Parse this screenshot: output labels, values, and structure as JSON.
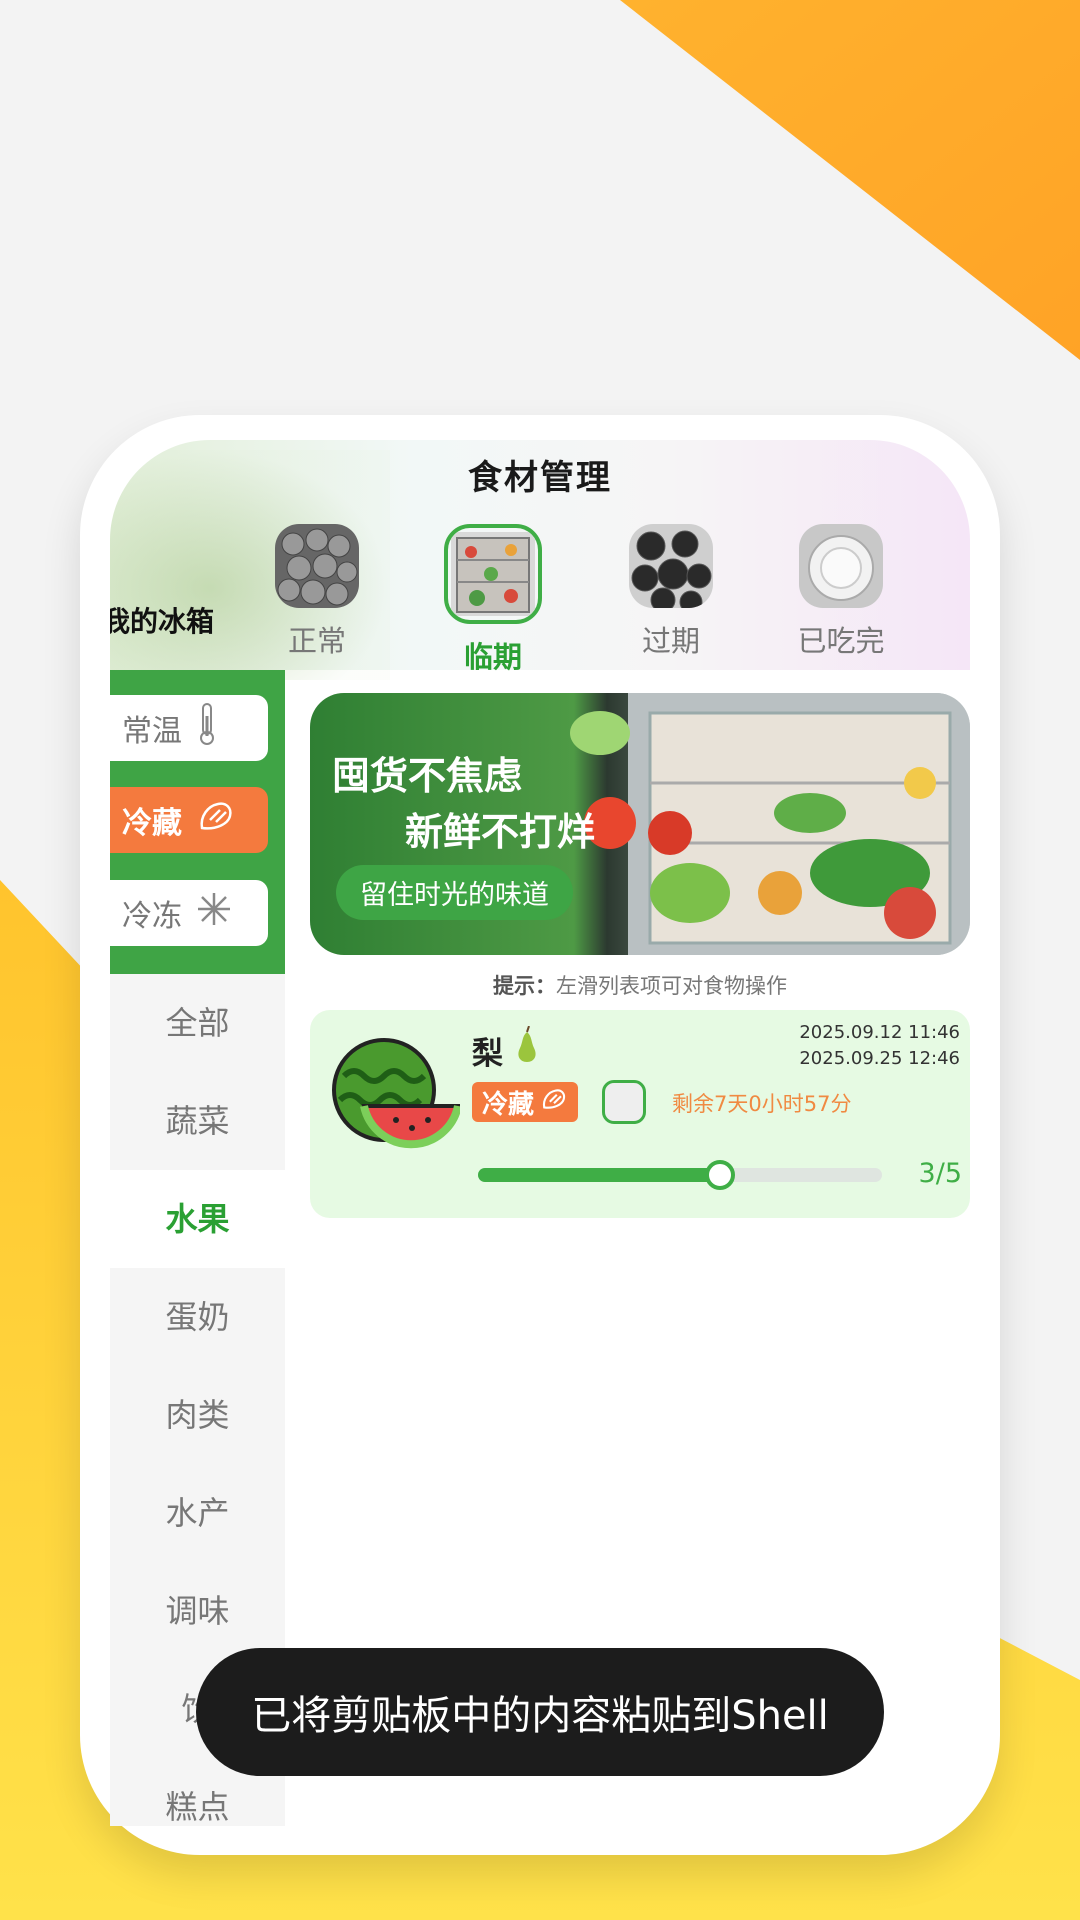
{
  "header": {
    "title": "食材管理",
    "fridge_label": "我的冰箱",
    "tabs": [
      {
        "label": "正常",
        "icon": "blueberries-image",
        "active": false
      },
      {
        "label": "临期",
        "icon": "fridge-image",
        "active": true
      },
      {
        "label": "过期",
        "icon": "dark-berries-image",
        "active": false
      },
      {
        "label": "已吃完",
        "icon": "empty-plate-image",
        "active": false
      }
    ]
  },
  "storage": {
    "items": [
      {
        "label": "常温",
        "icon": "thermometer-icon",
        "active": false
      },
      {
        "label": "冷藏",
        "icon": "cold-storage-icon",
        "active": true
      },
      {
        "label": "冷冻",
        "icon": "snowflake-icon",
        "active": false
      }
    ]
  },
  "categories": [
    "全部",
    "蔬菜",
    "水果",
    "蛋奶",
    "肉类",
    "水产",
    "调味",
    "饮",
    "糕点"
  ],
  "active_category": "水果",
  "banner": {
    "line1": "囤货不焦虑",
    "line2": "新鲜不打烊",
    "pill": "留住时光的味道"
  },
  "hint": {
    "prefix": "提示：",
    "text": "左滑列表项可对食物操作"
  },
  "item": {
    "name": "梨",
    "name_icon": "pear-icon",
    "image_icon": "watermelon-icon",
    "date_start": "2025.09.12 11:46",
    "date_end": "2025.09.25 12:46",
    "storage_tag": "冷藏",
    "remaining": "剩余7天0小时57分",
    "progress_value": 3,
    "progress_max": 5,
    "progress_text": "3/5"
  },
  "toast": "已将剪贴板中的内容粘贴到Shell",
  "colors": {
    "accent_green": "#3fae46",
    "accent_orange": "#f47a3e",
    "bg_yellow": "#ffd233"
  }
}
